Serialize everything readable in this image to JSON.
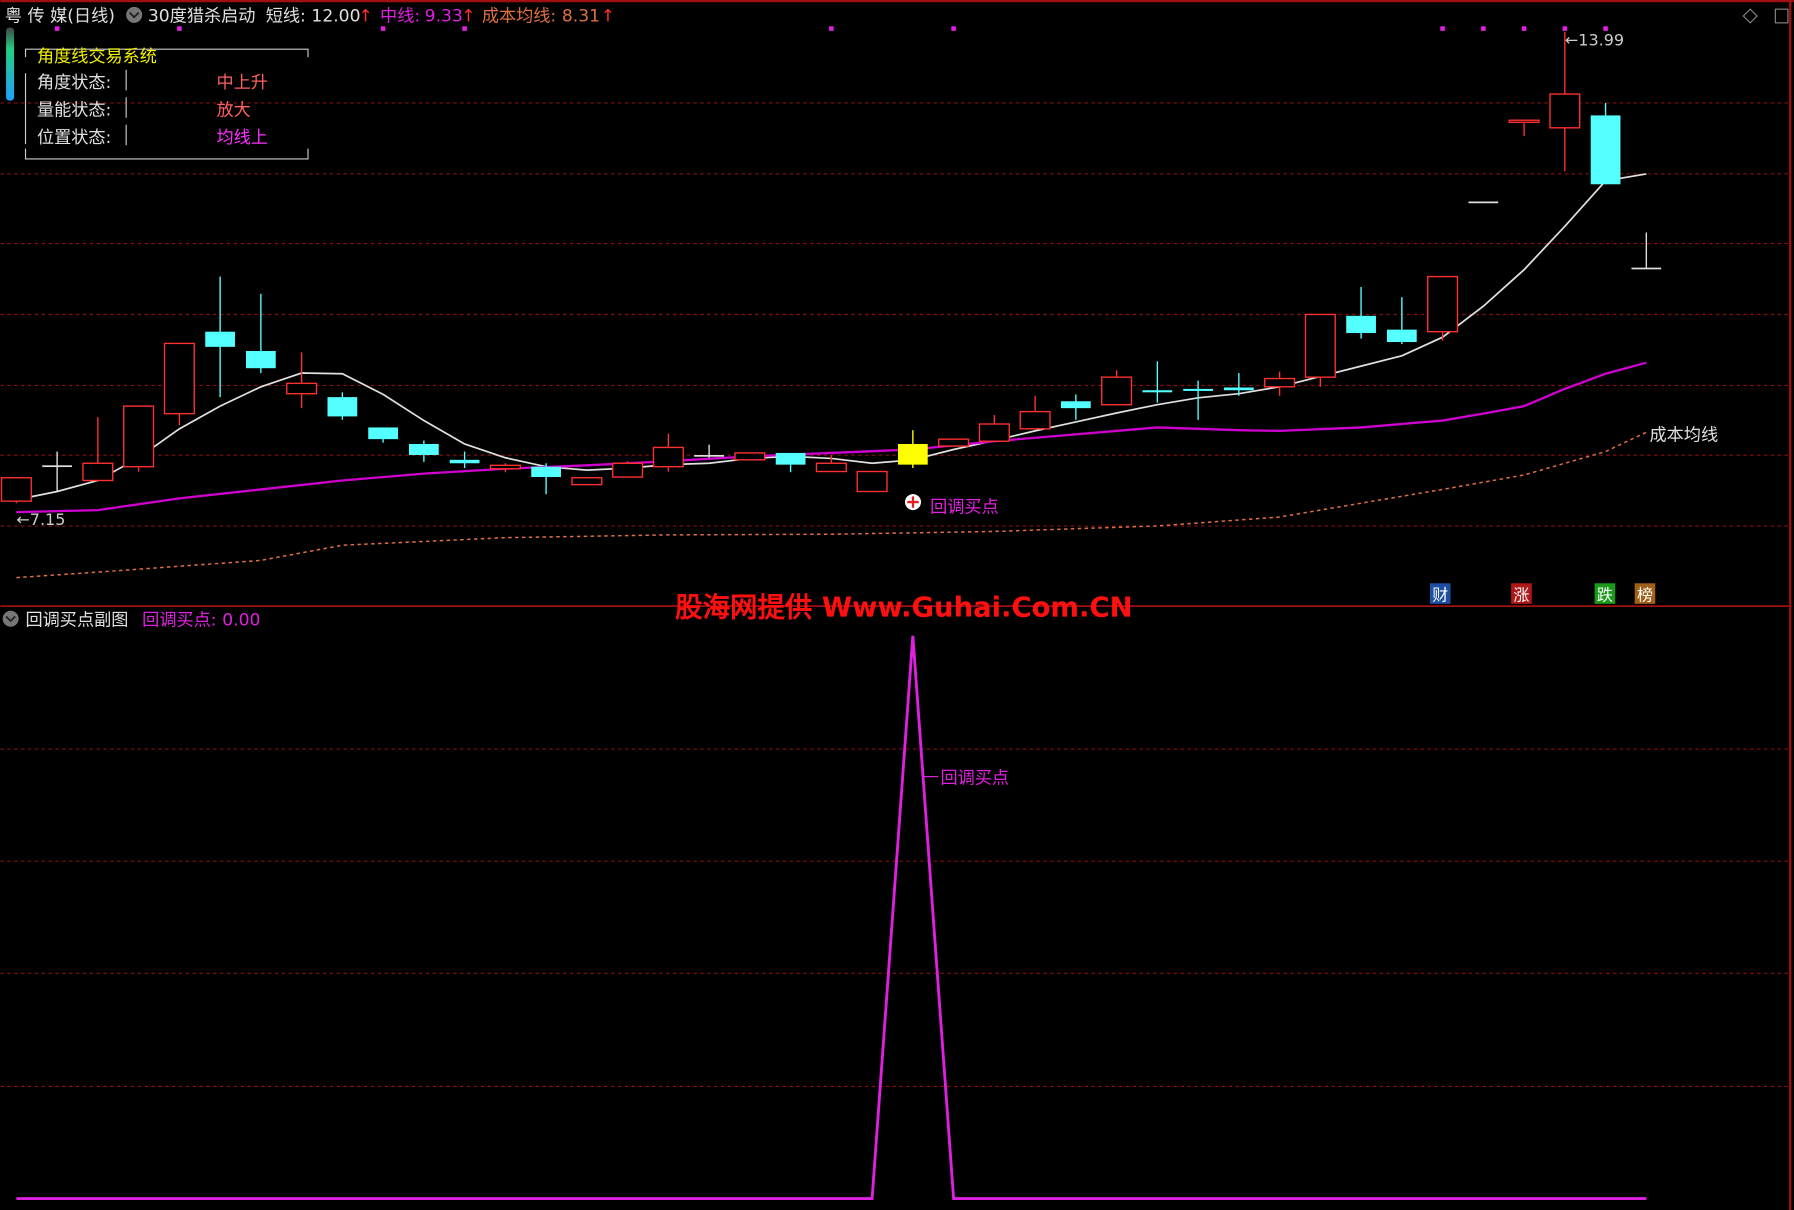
{
  "header": {
    "stock_name": "粤 传 媒(日线)",
    "indicator_name": "30度猎杀启动",
    "short_label": "短线:",
    "short_value": "12.00",
    "mid_label": "中线:",
    "mid_value": "9.33",
    "cost_label": "成本均线:",
    "cost_value": "8.31",
    "arrow": "↑"
  },
  "info_box": {
    "title": "角度线交易系统",
    "rows": [
      {
        "label": "角度状态:",
        "value": "中上升",
        "color": "#ff6060"
      },
      {
        "label": "量能状态:",
        "value": "放大",
        "color": "#ff6060"
      },
      {
        "label": "位置状态:",
        "value": "均线上",
        "color": "#ff30ff"
      }
    ]
  },
  "annotations": {
    "low_label": "7.15",
    "high_label": "13.99",
    "cost_line_label": "成本均线",
    "buy_point_label": "回调买点",
    "watermark": "股海网提供 Www.Guhai.Com.CN"
  },
  "badges": [
    {
      "text": "财",
      "color": "#1e4fa0"
    },
    {
      "text": "涨",
      "color": "#b01818"
    },
    {
      "text": "跌",
      "color": "#1a9a1a"
    },
    {
      "text": "榜",
      "color": "#a0601a"
    }
  ],
  "sub_header": {
    "title": "回调买点副图",
    "series_label": "回调买点:",
    "series_value": "0.00",
    "line_label": "回调买点"
  },
  "colors": {
    "up": "#ff3030",
    "down": "#54ffff",
    "signal": "#ffff00",
    "short_ma": "#e0e0e0",
    "mid_ma": "#d000d0",
    "cost_ma": "#e07040",
    "grid": "#8a1010",
    "sub_line": "#e020e0"
  },
  "chart_data": [
    {
      "type": "candlestick",
      "title": "粤 传 媒(日线)",
      "ylim": [
        5.8,
        14.2
      ],
      "grid": true,
      "candles": [
        {
          "o": 7.18,
          "h": 7.52,
          "l": 7.15,
          "c": 7.52
        },
        {
          "o": 7.7,
          "h": 7.9,
          "l": 7.32,
          "c": 7.7
        },
        {
          "o": 7.48,
          "h": 8.4,
          "l": 7.48,
          "c": 7.73
        },
        {
          "o": 7.68,
          "h": 8.56,
          "l": 7.61,
          "c": 8.56
        },
        {
          "o": 8.45,
          "h": 9.47,
          "l": 8.28,
          "c": 9.47
        },
        {
          "o": 9.64,
          "h": 10.44,
          "l": 8.69,
          "c": 9.42
        },
        {
          "o": 9.36,
          "h": 10.19,
          "l": 9.04,
          "c": 9.11
        },
        {
          "o": 8.74,
          "h": 9.34,
          "l": 8.53,
          "c": 8.89
        },
        {
          "o": 8.69,
          "h": 8.76,
          "l": 8.36,
          "c": 8.41
        },
        {
          "o": 8.25,
          "h": 8.25,
          "l": 8.03,
          "c": 8.08
        },
        {
          "o": 8.01,
          "h": 8.06,
          "l": 7.75,
          "c": 7.85
        },
        {
          "o": 7.78,
          "h": 7.9,
          "l": 7.66,
          "c": 7.73
        },
        {
          "o": 7.65,
          "h": 7.73,
          "l": 7.6,
          "c": 7.7
        },
        {
          "o": 7.68,
          "h": 7.73,
          "l": 7.28,
          "c": 7.53
        },
        {
          "o": 7.42,
          "h": 7.52,
          "l": 7.42,
          "c": 7.52
        },
        {
          "o": 7.53,
          "h": 7.76,
          "l": 7.53,
          "c": 7.73
        },
        {
          "o": 7.68,
          "h": 8.16,
          "l": 7.61,
          "c": 7.96
        },
        {
          "o": 7.85,
          "h": 8.0,
          "l": 7.81,
          "c": 7.85
        },
        {
          "o": 7.78,
          "h": 7.88,
          "l": 7.78,
          "c": 7.88
        },
        {
          "o": 7.88,
          "h": 7.88,
          "l": 7.6,
          "c": 7.71
        },
        {
          "o": 7.61,
          "h": 7.85,
          "l": 7.61,
          "c": 7.73
        },
        {
          "o": 7.32,
          "h": 7.61,
          "l": 7.32,
          "c": 7.61
        },
        {
          "o": 7.71,
          "h": 8.21,
          "l": 7.66,
          "c": 8.01,
          "signal": true
        },
        {
          "o": 7.98,
          "h": 8.08,
          "l": 7.98,
          "c": 8.08
        },
        {
          "o": 8.05,
          "h": 8.43,
          "l": 8.05,
          "c": 8.3
        },
        {
          "o": 8.23,
          "h": 8.71,
          "l": 8.23,
          "c": 8.48
        },
        {
          "o": 8.63,
          "h": 8.73,
          "l": 8.36,
          "c": 8.53
        },
        {
          "o": 8.58,
          "h": 9.08,
          "l": 8.58,
          "c": 8.98
        },
        {
          "o": 8.79,
          "h": 9.21,
          "l": 8.61,
          "c": 8.76
        },
        {
          "o": 8.81,
          "h": 8.93,
          "l": 8.36,
          "c": 8.78
        },
        {
          "o": 8.83,
          "h": 9.04,
          "l": 8.71,
          "c": 8.79
        },
        {
          "o": 8.84,
          "h": 9.06,
          "l": 8.71,
          "c": 8.96
        },
        {
          "o": 8.98,
          "h": 9.89,
          "l": 8.84,
          "c": 9.89
        },
        {
          "o": 9.87,
          "h": 10.29,
          "l": 9.54,
          "c": 9.62
        },
        {
          "o": 9.67,
          "h": 10.14,
          "l": 9.46,
          "c": 9.49
        },
        {
          "o": 9.64,
          "h": 10.44,
          "l": 9.51,
          "c": 10.44
        },
        {
          "o": 11.53,
          "h": 11.53,
          "l": 11.53,
          "c": 11.53
        },
        {
          "o": 12.68,
          "h": 12.71,
          "l": 12.48,
          "c": 12.71
        },
        {
          "o": 12.6,
          "h": 13.99,
          "l": 11.97,
          "c": 13.09
        },
        {
          "o": 12.78,
          "h": 12.96,
          "l": 11.78,
          "c": 11.78
        },
        {
          "o": 10.57,
          "h": 11.08,
          "l": 10.57,
          "c": 10.57
        }
      ],
      "series": [
        {
          "name": "短线",
          "index": [
            0,
            1,
            2,
            3,
            4,
            5,
            6,
            7,
            8,
            9,
            10,
            11,
            12,
            13,
            14,
            15,
            16,
            17,
            18,
            19,
            20,
            21,
            22,
            23,
            24,
            25,
            26,
            27,
            28,
            29,
            30,
            31,
            32,
            33,
            34,
            35,
            36,
            37,
            38,
            39,
            40
          ],
          "values": [
            7.2,
            7.32,
            7.48,
            7.81,
            8.23,
            8.56,
            8.84,
            9.04,
            9.03,
            8.73,
            8.35,
            8.01,
            7.81,
            7.68,
            7.63,
            7.66,
            7.71,
            7.73,
            7.8,
            7.83,
            7.8,
            7.73,
            7.78,
            7.93,
            8.06,
            8.2,
            8.33,
            8.46,
            8.58,
            8.68,
            8.74,
            8.84,
            8.99,
            9.14,
            9.29,
            9.56,
            10.01,
            10.54,
            11.17,
            11.83,
            11.93
          ]
        },
        {
          "name": "中线",
          "index": [
            0,
            2,
            4,
            6,
            8,
            10,
            12,
            14,
            16,
            18,
            20,
            22,
            24,
            26,
            28,
            30,
            31,
            33,
            35,
            36,
            37,
            38,
            39,
            40
          ],
          "values": [
            7.02,
            7.05,
            7.22,
            7.35,
            7.48,
            7.58,
            7.65,
            7.7,
            7.76,
            7.83,
            7.88,
            7.93,
            8.05,
            8.15,
            8.25,
            8.21,
            8.2,
            8.25,
            8.35,
            8.45,
            8.56,
            8.81,
            9.03,
            9.19
          ]
        },
        {
          "name": "成本均线",
          "index": [
            0,
            2,
            6,
            8,
            12,
            16,
            20,
            24,
            28,
            31,
            33,
            35,
            37,
            39,
            40
          ],
          "values": [
            6.07,
            6.15,
            6.32,
            6.54,
            6.65,
            6.69,
            6.7,
            6.74,
            6.82,
            6.95,
            7.15,
            7.35,
            7.56,
            7.9,
            8.18
          ]
        }
      ],
      "signal_marks_index": [
        1,
        4,
        9,
        11,
        20,
        23,
        35,
        36,
        37,
        38,
        39
      ]
    },
    {
      "type": "line",
      "title": "回调买点副图",
      "ylim": [
        0,
        1
      ],
      "series": [
        {
          "name": "回调买点",
          "values": [
            0,
            0,
            0,
            0,
            0,
            0,
            0,
            0,
            0,
            0,
            0,
            0,
            0,
            0,
            0,
            0,
            0,
            0,
            0,
            0,
            0,
            0,
            1,
            0,
            0,
            0,
            0,
            0,
            0,
            0,
            0,
            0,
            0,
            0,
            0,
            0,
            0,
            0,
            0,
            0,
            0
          ]
        }
      ]
    }
  ]
}
